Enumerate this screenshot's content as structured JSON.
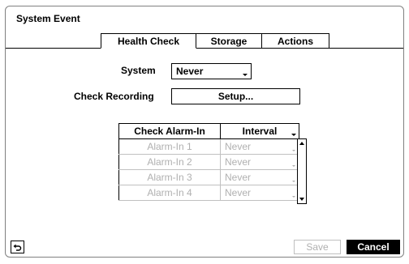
{
  "dialog": {
    "title": "System Event"
  },
  "tabs": [
    {
      "label": "Health Check",
      "active": true
    },
    {
      "label": "Storage",
      "active": false
    },
    {
      "label": "Actions",
      "active": false
    }
  ],
  "system": {
    "label": "System",
    "value": "Never"
  },
  "check_recording": {
    "label": "Check Recording",
    "button_label": "Setup..."
  },
  "alarm_table": {
    "headers": [
      "Check Alarm-In",
      "Interval"
    ],
    "rows": [
      {
        "alarm": "Alarm-In 1",
        "interval": "Never"
      },
      {
        "alarm": "Alarm-In 2",
        "interval": "Never"
      },
      {
        "alarm": "Alarm-In 3",
        "interval": "Never"
      },
      {
        "alarm": "Alarm-In 4",
        "interval": "Never"
      }
    ]
  },
  "footer": {
    "back_icon": "return-arrow-icon",
    "save_label": "Save",
    "cancel_label": "Cancel"
  },
  "colors": {
    "active_button": "#000000",
    "disabled_text": "#b0b0b0"
  }
}
